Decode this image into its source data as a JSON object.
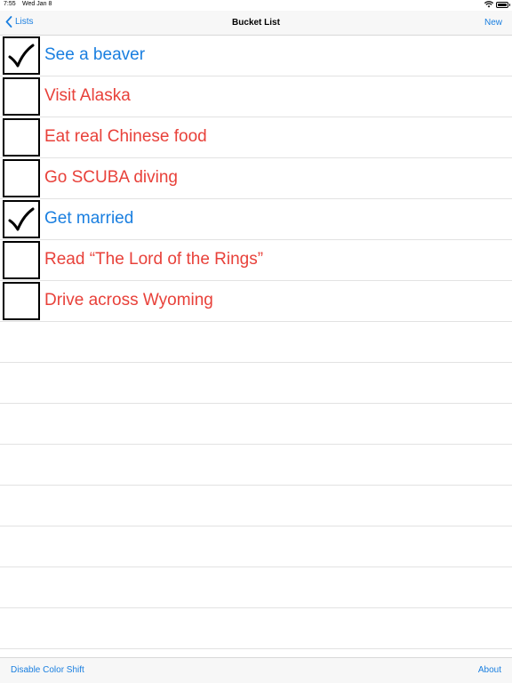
{
  "status_bar": {
    "time": "7:55",
    "date": "Wed Jan 8",
    "icons": [
      "wifi-icon",
      "battery-icon"
    ]
  },
  "nav": {
    "back_label": "Lists",
    "title": "Bucket List",
    "new_label": "New"
  },
  "items": [
    {
      "label": "See a beaver",
      "checked": true
    },
    {
      "label": "Visit Alaska",
      "checked": false
    },
    {
      "label": "Eat real Chinese food",
      "checked": false
    },
    {
      "label": "Go SCUBA diving",
      "checked": false
    },
    {
      "label": "Get married",
      "checked": true
    },
    {
      "label": "Read “The Lord of the Rings”",
      "checked": false
    },
    {
      "label": "Drive across Wyoming",
      "checked": false
    }
  ],
  "toolbar": {
    "left_label": "Disable Color Shift",
    "right_label": "About"
  },
  "colors": {
    "accent": "#1a7fe0",
    "done_text": "#1a7fe0",
    "todo_text": "#e8413a"
  }
}
